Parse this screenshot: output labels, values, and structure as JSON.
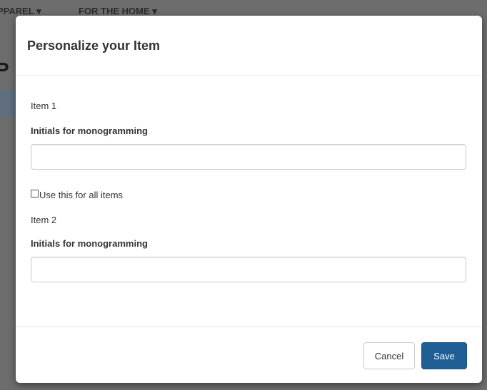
{
  "background": {
    "nav_items": [
      "PPAREL ▾",
      "FOR THE HOME ▾"
    ],
    "heading": "P"
  },
  "modal": {
    "title": "Personalize your Item",
    "items": [
      {
        "label": "Item 1",
        "field_label": "Initials for monogramming",
        "value": ""
      },
      {
        "label": "Item 2",
        "field_label": "Initials for monogramming",
        "value": ""
      }
    ],
    "use_for_all": {
      "label": "Use this for all items",
      "checked": false
    },
    "footer": {
      "cancel_label": "Cancel",
      "save_label": "Save"
    }
  },
  "colors": {
    "primary": "#1f5f96",
    "backdrop": "#6d6d6d"
  }
}
